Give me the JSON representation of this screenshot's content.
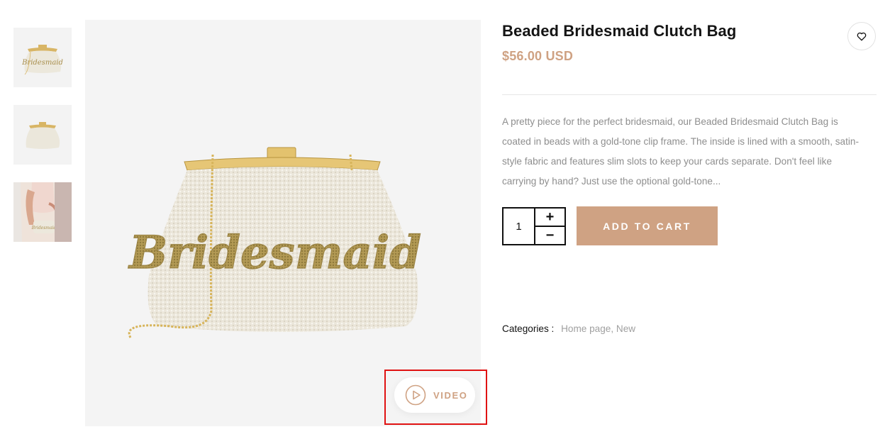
{
  "product": {
    "title": "Beaded Bridesmaid Clutch Bag",
    "price": "$56.00 USD",
    "description": "A pretty piece for the perfect bridesmaid, our Beaded Bridesmaid Clutch Bag is coated in beads with a gold-tone clip frame. The inside is lined with a smooth, satin-style fabric and features slim slots to keep your cards separate. Don't feel like carrying by hand? Just use the optional gold-tone...",
    "quantity": "1",
    "plus_label": "+",
    "minus_label": "−",
    "add_to_cart_label": "ADD TO CART",
    "categories_label": "Categories :",
    "categories_value": "Home page, New"
  },
  "gallery": {
    "bag_text": "Bridesmaid",
    "video_label": "VIDEO",
    "thumbnails": [
      {
        "name": "thumb-front",
        "text": "Bridesmaid"
      },
      {
        "name": "thumb-back",
        "text": ""
      },
      {
        "name": "thumb-model",
        "text": "Bridesmaid"
      }
    ]
  },
  "icons": {
    "wishlist": "heart-icon",
    "video": "play-circle-icon"
  },
  "colors": {
    "accent": "#cfa283",
    "highlight": "#e01212",
    "text": "#111111",
    "muted": "#8e8e8e"
  }
}
